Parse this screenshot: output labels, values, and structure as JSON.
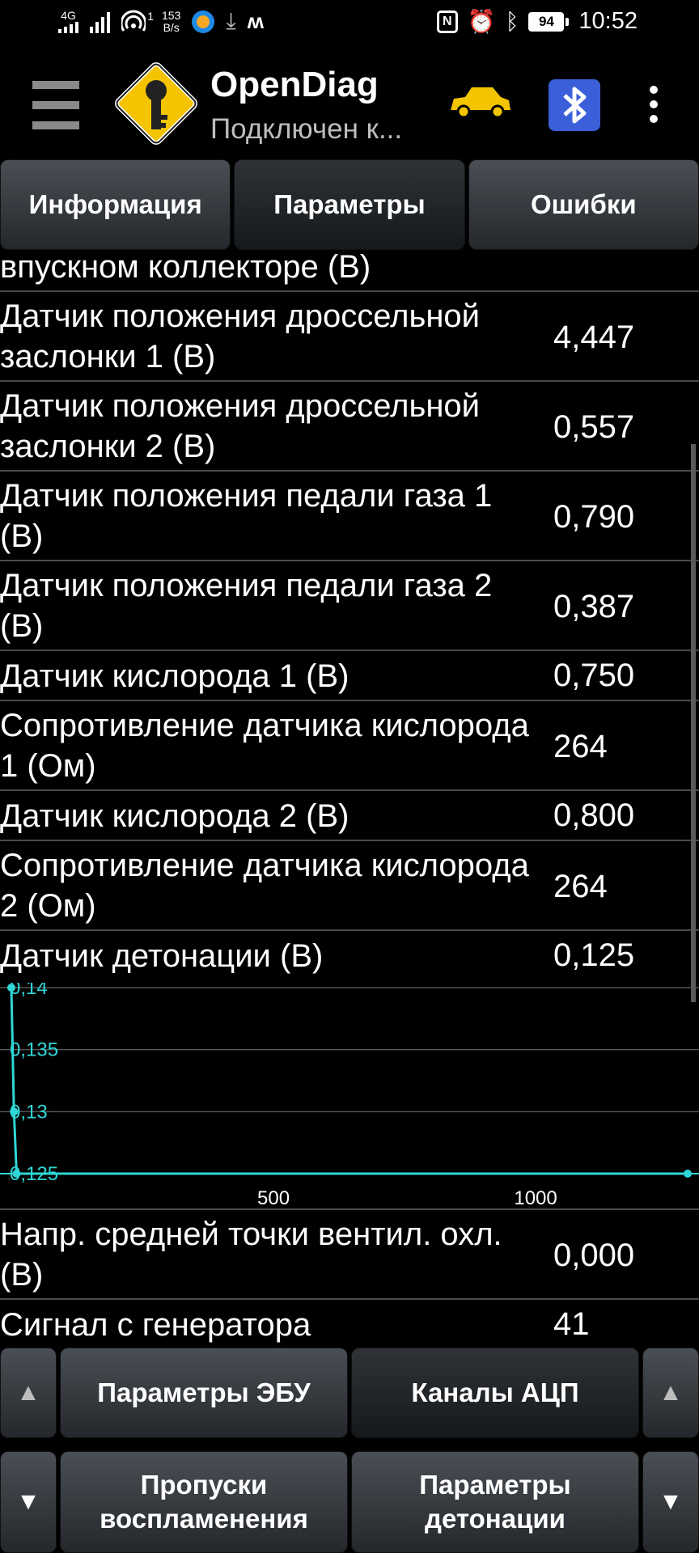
{
  "status_bar": {
    "network": "4G",
    "net_speed_value": "153",
    "net_speed_unit": "B/s",
    "hotspot_count": "1",
    "battery": "94",
    "time": "10:52",
    "icons": [
      "signal-4g-icon",
      "signal-icon",
      "hotspot-icon",
      "app-icon",
      "download-icon",
      "m-icon",
      "nfc-icon",
      "alarm-icon",
      "bluetooth-icon",
      "battery-icon"
    ]
  },
  "app_bar": {
    "title": "OpenDiag",
    "subtitle": "Подключен к..."
  },
  "tabs": [
    {
      "label": "Информация",
      "active": false
    },
    {
      "label": "Параметры",
      "active": true
    },
    {
      "label": "Ошибки",
      "active": false
    }
  ],
  "parameters": [
    {
      "name": "впускном коллекторе (В)",
      "value": ""
    },
    {
      "name": "Датчик положения дроссельной заслонки 1 (В)",
      "value": "4,447"
    },
    {
      "name": "Датчик положения дроссельной заслонки 2 (В)",
      "value": "0,557"
    },
    {
      "name": "Датчик положения педали газа 1 (В)",
      "value": "0,790"
    },
    {
      "name": "Датчик положения педали газа 2 (В)",
      "value": "0,387"
    },
    {
      "name": "Датчик кислорода 1 (В)",
      "value": "0,750"
    },
    {
      "name": "Сопротивление датчика кислорода 1 (Ом)",
      "value": "264"
    },
    {
      "name": "Датчик кислорода 2 (В)",
      "value": "0,800"
    },
    {
      "name": "Сопротивление датчика кислорода 2 (Ом)",
      "value": "264"
    },
    {
      "name": "Датчик детонации (В)",
      "value": "0,125"
    },
    {
      "name": "Напр. средней точки вентил. охл. (В)",
      "value": "0,000"
    },
    {
      "name": "Сигнал с генератора",
      "value": "41"
    }
  ],
  "chart_data": {
    "type": "line",
    "color": "#2fd6d6",
    "y_tick_labels": [
      "0,14",
      "0,135",
      "0,13",
      "0,125"
    ],
    "y_ticks": [
      0.14,
      0.135,
      0.13,
      0.125
    ],
    "x_tick_labels": [
      "500",
      "1000"
    ],
    "x_ticks": [
      500,
      1000
    ],
    "xlim": [
      0,
      1290
    ],
    "ylim": [
      0.125,
      0.14
    ],
    "grid": true,
    "points": [
      {
        "x": 0,
        "y": 0.14
      },
      {
        "x": 5,
        "y": 0.13
      },
      {
        "x": 10,
        "y": 0.125
      },
      {
        "x": 1290,
        "y": 0.125
      }
    ]
  },
  "bottom_nav": {
    "up_arrow": "▲",
    "down_arrow": "▼",
    "buttons": [
      {
        "label": "Параметры ЭБУ",
        "active": false
      },
      {
        "label": "Каналы АЦП",
        "active": true
      },
      {
        "label": "Пропуски воспламенения",
        "active": false
      },
      {
        "label": "Параметры детонации",
        "active": false
      }
    ]
  }
}
